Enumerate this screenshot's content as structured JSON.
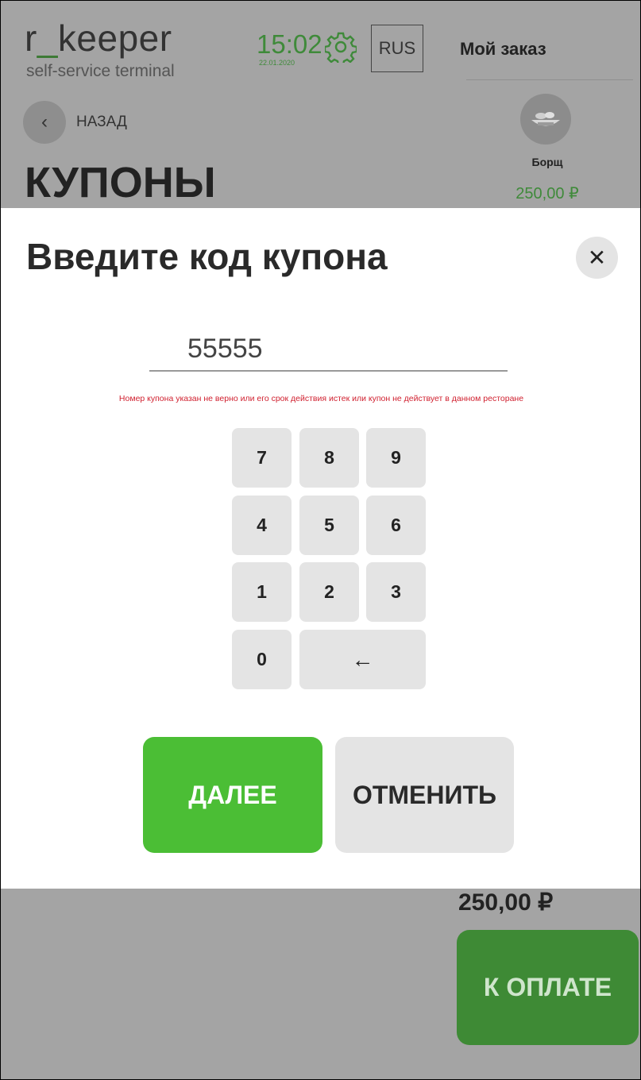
{
  "header": {
    "logo_main": "r_keeper",
    "logo_sub": "self-service terminal",
    "time": "15:02",
    "date": "22.01.2020",
    "settings_icon": "gear-icon",
    "language": "RUS",
    "order_title": "Мой заказ"
  },
  "nav": {
    "back_icon": "chevron-left-icon",
    "back_label": "НАЗАД",
    "page_title": "КУПОНЫ"
  },
  "order_item": {
    "name": "Борщ",
    "price": "250,00 ₽"
  },
  "footer": {
    "total": "250,00 ₽",
    "pay_button": "К ОПЛАТЕ"
  },
  "modal": {
    "title": "Введите код купона",
    "close_icon": "close-icon",
    "code_value": "55555",
    "error_message": "Номер купона указан не верно или его срок действия истек или купон не действует в данном ресторане",
    "keypad": {
      "k7": "7",
      "k8": "8",
      "k9": "9",
      "k4": "4",
      "k5": "5",
      "k6": "6",
      "k1": "1",
      "k2": "2",
      "k3": "3",
      "k0": "0",
      "backspace": "←"
    },
    "next_button": "ДАЛЕЕ",
    "cancel_button": "ОТМЕНИТЬ"
  },
  "colors": {
    "accent_green": "#4bbe35",
    "dim_green": "#3e8a35",
    "error_red": "#d01f2e",
    "overlay_gray": "#a4a4a4",
    "key_gray": "#e4e4e4"
  }
}
